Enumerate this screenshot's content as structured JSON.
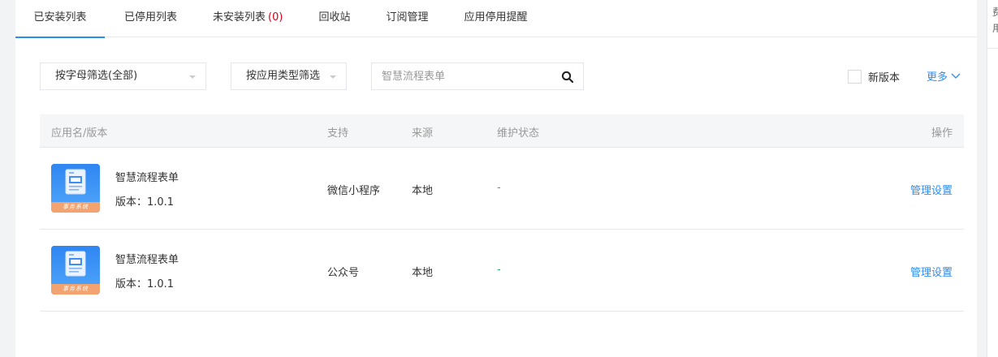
{
  "tabs": [
    {
      "label": "已安装列表"
    },
    {
      "label": "已停用列表"
    },
    {
      "label": "未安装列表",
      "count": "(0)"
    },
    {
      "label": "回收站"
    },
    {
      "label": "订阅管理"
    },
    {
      "label": "应用停用提醒"
    }
  ],
  "filters": {
    "alpha_select": "按字母筛选(全部)",
    "type_select": "按应用类型筛选",
    "search_placeholder": "智慧流程表单",
    "new_version_label": "新版本",
    "more_label": "更多"
  },
  "table": {
    "headers": {
      "name": "应用名/版本",
      "support": "支持",
      "source": "来源",
      "status": "维护状态",
      "operation": "操作"
    },
    "rows": [
      {
        "name": "智慧流程表单",
        "version": "版本：1.0.1",
        "support": "微信小程序",
        "source": "本地",
        "status": "-",
        "action": "管理设置",
        "icon_caption": "事务系统"
      },
      {
        "name": "智慧流程表单",
        "version": "版本：1.0.1",
        "support": "公众号",
        "source": "本地",
        "status": "-",
        "action": "管理设置",
        "icon_caption": "事务系统"
      }
    ]
  },
  "right_edge": {
    "frag1": "费",
    "frag2": "用"
  },
  "colors": {
    "accent": "#2d8cf0",
    "count_red": "#d9001b",
    "status_green": "#19be6b"
  }
}
